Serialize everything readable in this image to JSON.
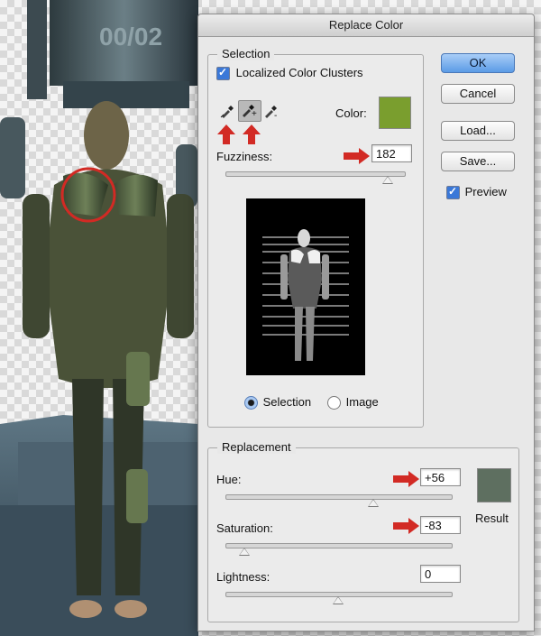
{
  "dialog": {
    "title": "Replace Color"
  },
  "canvas": {
    "frame_label": "00/02"
  },
  "selection": {
    "group_title": "Selection",
    "localized_label": "Localized Color Clusters",
    "localized_checked": true,
    "color_label": "Color:",
    "color_value": "#7a9e2e",
    "fuzziness_label": "Fuzziness:",
    "fuzziness_value": "182",
    "fuzziness_level": 182,
    "fuzziness_max": 200,
    "radio_selection": "Selection",
    "radio_image": "Image",
    "radio_selected": "Selection"
  },
  "buttons": {
    "ok": "OK",
    "cancel": "Cancel",
    "load": "Load...",
    "save": "Save...",
    "preview_label": "Preview",
    "preview_checked": true
  },
  "replacement": {
    "group_title": "Replacement",
    "hue_label": "Hue:",
    "hue_value": "+56",
    "hue_level": 56,
    "saturation_label": "Saturation:",
    "saturation_value": "-83",
    "saturation_level": -83,
    "lightness_label": "Lightness:",
    "lightness_value": "0",
    "lightness_level": 0,
    "result_label": "Result",
    "result_color": "#5e6f60"
  },
  "colors": {
    "annotation_red": "#d22a24",
    "accent_blue": "#3a78d8"
  }
}
